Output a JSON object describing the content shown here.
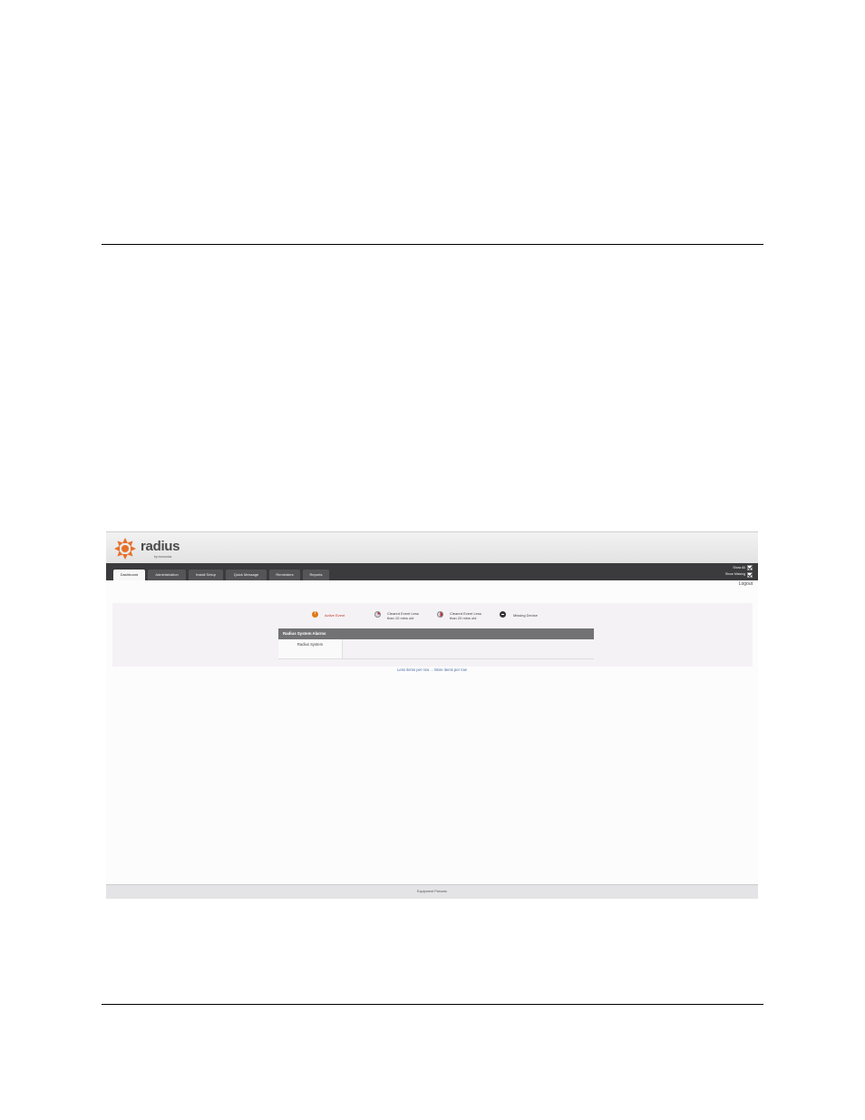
{
  "app": {
    "logo_word": "radius",
    "logo_sub": "by inovonics",
    "brand_color": "#e8702a"
  },
  "nav": {
    "tabs": [
      "Dashboard",
      "Administration",
      "Install Setup",
      "Quick Message",
      "Reminders",
      "Reports"
    ],
    "active_tab": "Dashboard",
    "show_all_label": "Show All",
    "show_missing_label": "Show Missing",
    "show_all_checked": true,
    "show_missing_checked": true,
    "logout_label": "Logout"
  },
  "legend": {
    "active_event": "Active Event",
    "cleared_10_line1": "Cleared Event Less",
    "cleared_10_line2": "than 10 mins old",
    "cleared_20_line1": "Cleared Event Less",
    "cleared_20_line2": "than 20 mins old",
    "missing_device": "Missing Device",
    "active_color": "#c0392b"
  },
  "alarms": {
    "title": "Radius System Alarms",
    "rows": [
      {
        "name": "Radius System"
      }
    ]
  },
  "row_controls": {
    "less": "Less items per row",
    "separator": " ... ",
    "more": "More items per row"
  },
  "footer": {
    "label": "Equipment Pictures"
  }
}
